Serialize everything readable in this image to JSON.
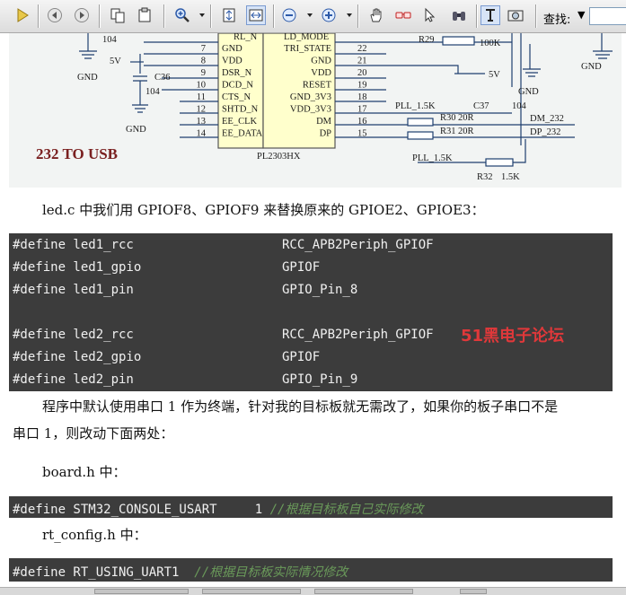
{
  "toolbar": {
    "buttons": [
      "play-icon",
      "back-icon",
      "forward-icon",
      "copy-page-icon",
      "paste-page-icon",
      "zoom-in-icon",
      "fit-page-icon",
      "fit-width-icon",
      "zoom-out-minus-icon",
      "zoom-in-plus-icon",
      "hand-tool-icon",
      "glasses-icon",
      "cursor-icon",
      "binoculars-icon",
      "text-select-icon",
      "snapshot-icon"
    ],
    "find_label": "查找:",
    "find_value": ""
  },
  "schematic": {
    "chip_name": "PL2303HX",
    "title": "232 TO USB",
    "pins_left": [
      {
        "num": "7",
        "name": "GND"
      },
      {
        "num": "8",
        "name": "VDD"
      },
      {
        "num": "9",
        "name": "DSR_N"
      },
      {
        "num": "10",
        "name": "DCD_N"
      },
      {
        "num": "11",
        "name": "CTS_N"
      },
      {
        "num": "12",
        "name": "SHTD_N"
      },
      {
        "num": "13",
        "name": "EE_CLK"
      },
      {
        "num": "14",
        "name": "EE_DATA"
      }
    ],
    "pins_right": [
      {
        "num": "22",
        "name": "TRI_STATE"
      },
      {
        "num": "21",
        "name": "GND"
      },
      {
        "num": "20",
        "name": "VDD"
      },
      {
        "num": "19",
        "name": "RESET"
      },
      {
        "num": "18",
        "name": "GND_3V3"
      },
      {
        "num": "17",
        "name": "VDD_3V3"
      },
      {
        "num": "16",
        "name": "DM"
      },
      {
        "num": "15",
        "name": "DP"
      }
    ],
    "top_left_pin": "RL_N",
    "top_right_pin": "LD_MODE",
    "labels": {
      "cap_104_top": "104",
      "v5_left": "5V",
      "c36": "C36",
      "c36_val": "104",
      "gnd1": "GND",
      "gnd2": "GND",
      "gnd3": "GND",
      "gnd4": "GND",
      "r29": "R29",
      "r29_val": "100K",
      "v5_right": "5V",
      "pll1": "PLL_1.5K",
      "c37": "C37",
      "c37_val": "104",
      "r30": "R30",
      "r30_val": "20R",
      "r31": "R31",
      "r31_val": "20R",
      "dm": "DM_232",
      "dp": "DP_232",
      "pll2": "PLL_1.5K",
      "r32": "R32",
      "r32_val": "1.5K"
    }
  },
  "text": {
    "p1": "led.c 中我们用 GPIOF8、GPIOF9 来替换原来的 GPIOE2、GPIOE3：",
    "p2a": "程序中默认使用串口 1 作为终端，针对我的目标板就无需改了，如果你的板子串口不是",
    "p2b": "串口 1，则改动下面两处：",
    "p3": "board.h 中：",
    "p4": "rt_config.h 中："
  },
  "code1": {
    "rows": [
      {
        "name": "#define led1_rcc",
        "value": "RCC_APB2Periph_GPIOF"
      },
      {
        "name": "#define led1_gpio",
        "value": "GPIOF"
      },
      {
        "name": "#define led1_pin",
        "value": "GPIO_Pin_8"
      },
      {
        "name": "",
        "value": ""
      },
      {
        "name": "#define led2_rcc",
        "value": "RCC_APB2Periph_GPIOF"
      },
      {
        "name": "#define led2_gpio",
        "value": "GPIOF"
      },
      {
        "name": "#define led2_pin",
        "value": "GPIO_Pin_9"
      }
    ]
  },
  "code2": {
    "code": "#define STM32_CONSOLE_USART     1 ",
    "comment": "//根据目标板自己实际修改"
  },
  "code3": {
    "code": "#define RT_USING_UART1  ",
    "comment": "//根据目标板实际情况修改"
  },
  "watermark": "51黑电子论坛",
  "colors": {
    "code_bg": "#3c3c3c",
    "comment": "#6a9a5a",
    "watermark": "#e0383a",
    "wire": "#1f3f6f"
  }
}
